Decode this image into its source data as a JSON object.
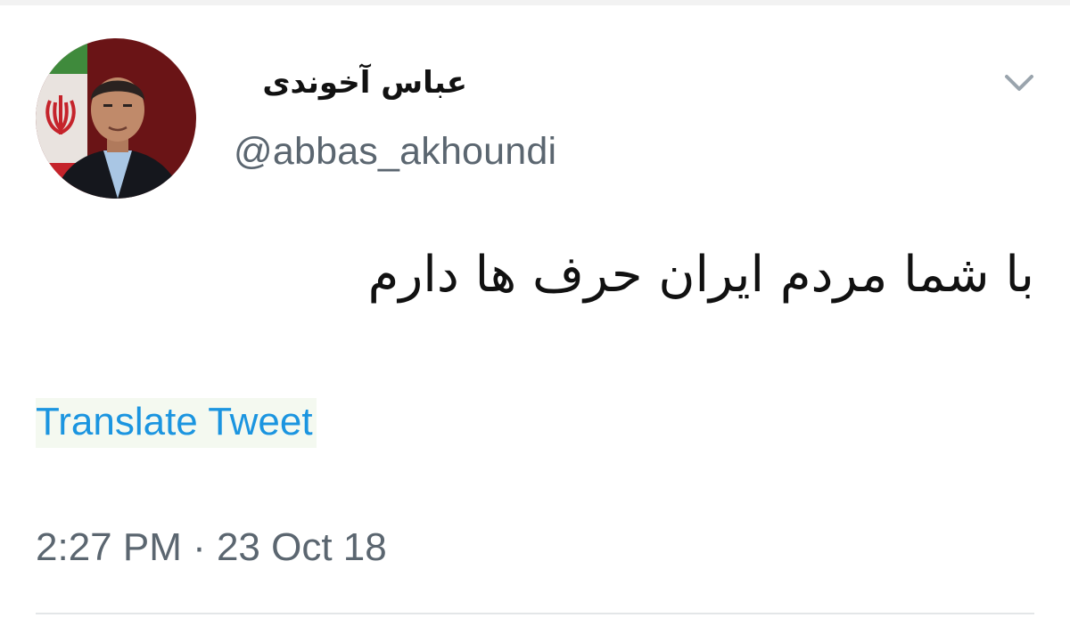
{
  "tweet": {
    "display_name": "عباس آخوندی",
    "handle": "@abbas_akhoundi",
    "text": "با شما مردم ایران حرف ها دارم",
    "translate_label": "Translate Tweet",
    "timestamp": "2:27 PM · 23 Oct 18"
  },
  "icons": {
    "menu": "chevron-down-icon",
    "avatar": "profile-photo"
  },
  "colors": {
    "link": "#1b95e0",
    "secondary_text": "#5b6670",
    "primary_text": "#111111",
    "divider": "#e3e6e8"
  }
}
